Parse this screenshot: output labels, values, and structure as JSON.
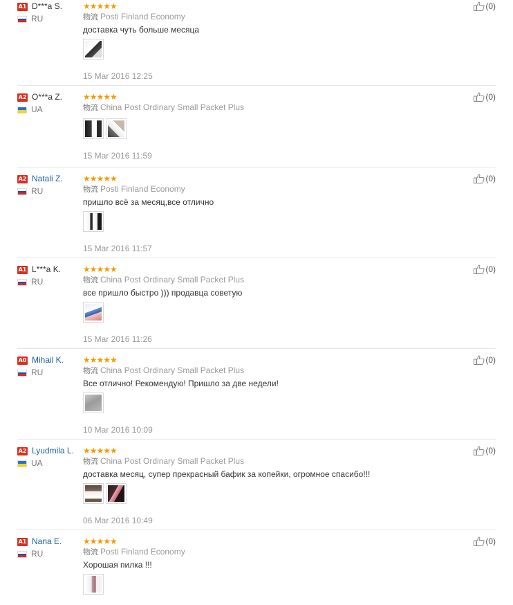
{
  "reviews": [
    {
      "level": "A1",
      "name": "D***a S.",
      "name_link": false,
      "country": "RU",
      "flag": "ru",
      "stars": "★★★★★",
      "logistics_cn": "物流",
      "logistics": "Posti Finland Economy",
      "text": "доставка чуть больше месяца",
      "thumbs": [
        "photo-white-file"
      ],
      "date": "15 Mar 2016 12:25",
      "useful": "(0)"
    },
    {
      "level": "A2",
      "name": "O***a Z.",
      "name_link": false,
      "country": "UA",
      "flag": "ua",
      "stars": "★★★★★",
      "logistics_cn": "物流",
      "logistics": "China Post Ordinary Small Packet Plus",
      "text": "",
      "thumbs": [
        "photo-file-dark",
        "photo-file-hand"
      ],
      "date": "15 Mar 2016 11:59",
      "useful": "(0)"
    },
    {
      "level": "A2",
      "name": "Natali Z.",
      "name_link": true,
      "country": "RU",
      "flag": "ru",
      "stars": "★★★★★",
      "logistics_cn": "物流",
      "logistics": "Posti Finland Economy",
      "text": "пришло всё за месяц,все отлично",
      "thumbs": [
        "photo-files-pair"
      ],
      "date": "15 Mar 2016 11:57",
      "useful": "(0)"
    },
    {
      "level": "A1",
      "name": "L***a K.",
      "name_link": false,
      "country": "RU",
      "flag": "ru",
      "stars": "★★★★★",
      "logistics_cn": "物流",
      "logistics": "China Post Ordinary Small Packet Plus",
      "text": "все пришло быстро ))) продавца советую",
      "thumbs": [
        "photo-file-blue"
      ],
      "date": "15 Mar 2016 11:26",
      "useful": "(0)"
    },
    {
      "level": "A0",
      "name": "Mihail K.",
      "name_link": true,
      "country": "RU",
      "flag": "ru",
      "stars": "★★★★★",
      "logistics_cn": "物流",
      "logistics": "China Post Ordinary Small Packet Plus",
      "text": "Все отличнo! Рекомендую! Пришло за две недели!",
      "thumbs": [
        "photo-gray"
      ],
      "date": "10 Mar 2016 10:09",
      "useful": "(0)"
    },
    {
      "level": "A2",
      "name": "Lyudmila L.",
      "name_link": true,
      "country": "UA",
      "flag": "ua",
      "stars": "★★★★★",
      "logistics_cn": "物流",
      "logistics": "China Post Ordinary Small Packet Plus",
      "text": "доставка месяц, супер прекрасный бафик за копейки, огромное спасибо!!!",
      "thumbs": [
        "photo-buffer",
        "photo-hand-dark"
      ],
      "date": "06 Mar 2016 10:49",
      "useful": "(0)"
    },
    {
      "level": "A1",
      "name": "Nana E.",
      "name_link": true,
      "country": "RU",
      "flag": "ru",
      "stars": "★★★★★",
      "logistics_cn": "物流",
      "logistics": "Posti Finland Economy",
      "text": "Хорошая пилка !!!",
      "thumbs": [
        "photo-file-pink"
      ],
      "date": "",
      "useful": "(0)"
    }
  ],
  "colors": {
    "level_badge": "#d9301f",
    "star": "#f29b00",
    "link": "#1a5ea7",
    "flag_ru": [
      "#ffffff",
      "#1f4fb5",
      "#d52b1e"
    ],
    "flag_ua": [
      "#2a6fd3",
      "#f7d417"
    ]
  }
}
